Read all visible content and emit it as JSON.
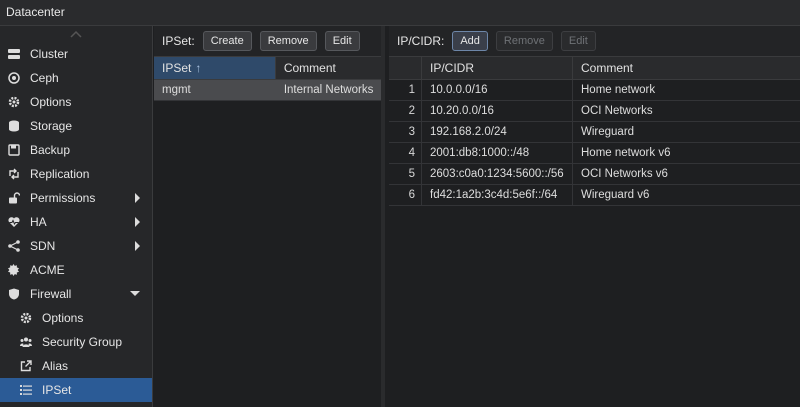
{
  "window": {
    "title": "Datacenter"
  },
  "sidebar": {
    "items": [
      {
        "label": "Cluster",
        "icon": "server-icon"
      },
      {
        "label": "Ceph",
        "icon": "ceph-icon"
      },
      {
        "label": "Options",
        "icon": "gear-icon"
      },
      {
        "label": "Storage",
        "icon": "database-icon"
      },
      {
        "label": "Backup",
        "icon": "floppy-icon"
      },
      {
        "label": "Replication",
        "icon": "retweet-icon"
      },
      {
        "label": "Permissions",
        "icon": "unlock-icon"
      },
      {
        "label": "HA",
        "icon": "heartbeat-icon"
      },
      {
        "label": "SDN",
        "icon": "sdn-icon"
      },
      {
        "label": "ACME",
        "icon": "certificate-icon"
      },
      {
        "label": "Firewall",
        "icon": "shield-icon"
      },
      {
        "label": "Options",
        "icon": "gear-icon"
      },
      {
        "label": "Security Group",
        "icon": "users-icon"
      },
      {
        "label": "Alias",
        "icon": "external-link-icon"
      },
      {
        "label": "IPSet",
        "icon": "list-icon"
      }
    ]
  },
  "ipset_panel": {
    "toolbar_label": "IPSet:",
    "create_label": "Create",
    "remove_label": "Remove",
    "edit_label": "Edit",
    "columns": [
      "IPSet",
      "Comment"
    ],
    "rows": [
      {
        "name": "mgmt",
        "comment": "Internal Networks"
      }
    ]
  },
  "cidr_panel": {
    "toolbar_label": "IP/CIDR:",
    "add_label": "Add",
    "remove_label": "Remove",
    "edit_label": "Edit",
    "columns": [
      "IP/CIDR",
      "Comment"
    ],
    "rows": [
      {
        "index": "1",
        "cidr": "10.0.0.0/16",
        "comment": "Home network"
      },
      {
        "index": "2",
        "cidr": "10.20.0.0/16",
        "comment": "OCI Networks"
      },
      {
        "index": "3",
        "cidr": "192.168.2.0/24",
        "comment": "Wireguard"
      },
      {
        "index": "4",
        "cidr": "2001:db8:1000::/48",
        "comment": "Home network v6"
      },
      {
        "index": "5",
        "cidr": "2603:c0a0:1234:5600::/56",
        "comment": "OCI Networks v6"
      },
      {
        "index": "6",
        "cidr": "fd42:1a2b:3c4d:5e6f::/64",
        "comment": "Wireguard v6"
      }
    ]
  },
  "colors": {
    "accent": "#2b5b96",
    "background": "#1e1f21"
  }
}
